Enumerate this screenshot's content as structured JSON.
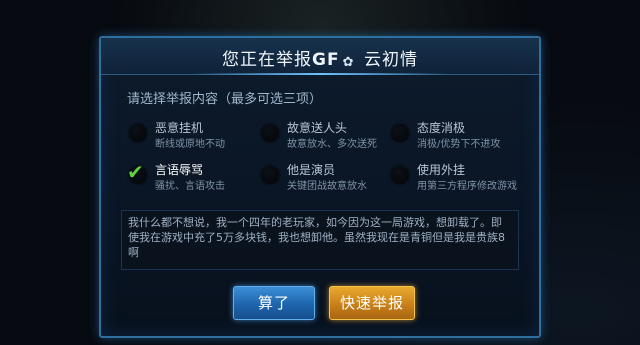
{
  "dialog": {
    "title_prefix": "您正在举报",
    "reported_name": "GF",
    "name_mark": "✿",
    "title_suffix": "云初情"
  },
  "prompt": "请选择举报内容（最多可选三项）",
  "options": [
    {
      "label": "恶意挂机",
      "desc": "断线或原地不动",
      "checked": false
    },
    {
      "label": "故意送人头",
      "desc": "故意放水、多次送死",
      "checked": false
    },
    {
      "label": "态度消极",
      "desc": "消极/优势下不进攻",
      "checked": false
    },
    {
      "label": "言语辱骂",
      "desc": "骚扰、言语攻击",
      "checked": true
    },
    {
      "label": "他是演员",
      "desc": "关键团战故意放水",
      "checked": false
    },
    {
      "label": "使用外挂",
      "desc": "用第三方程序修改游戏",
      "checked": false
    }
  ],
  "check_glyph": "✔",
  "comment": "我什么都不想说，我一个四年的老玩家，如今因为这一局游戏，想卸载了。即使我在游戏中充了5万多块钱，我也想卸他。虽然我现在是青铜但是我是贵族8啊",
  "buttons": {
    "cancel": "算了",
    "submit": "快速举报"
  },
  "colors": {
    "check": "#5ed23a",
    "cancel_button": "#1d64ad",
    "submit_button": "#c9801a",
    "frame": "#2f6f9e"
  }
}
